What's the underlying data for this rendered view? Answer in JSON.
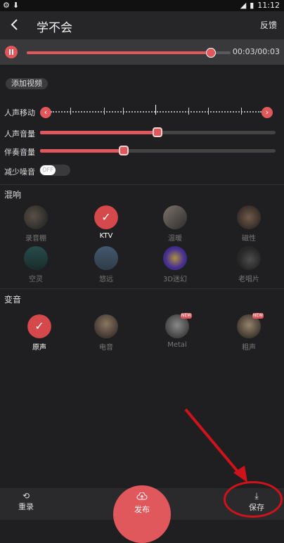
{
  "status": {
    "time": "11:12",
    "battery_icon": "battery-icon",
    "wifi_icon": "wifi-icon"
  },
  "header": {
    "title": "学不会",
    "feedback": "反馈"
  },
  "player": {
    "time": "00:03/00:03",
    "progress": 0.92
  },
  "add_video": "添加视频",
  "vocal_shift": {
    "label": "人声移动",
    "value": 0.5
  },
  "vocal_volume": {
    "label": "人声音量",
    "value": 0.5
  },
  "accompaniment_volume": {
    "label": "伴奏音量",
    "value": 0.36
  },
  "noise_reduction": {
    "label": "减少噪音",
    "state": "OFF"
  },
  "reverb": {
    "title": "混响",
    "items": [
      {
        "label": "录音棚",
        "icon": "studio-mic-icon",
        "active": false
      },
      {
        "label": "KTV",
        "icon": "check-icon",
        "active": true
      },
      {
        "label": "温暖",
        "icon": "piano-icon",
        "active": false
      },
      {
        "label": "磁性",
        "icon": "guitar-icon",
        "active": false
      },
      {
        "label": "空灵",
        "icon": "forest-icon",
        "active": false
      },
      {
        "label": "悠远",
        "icon": "birds-icon",
        "active": false
      },
      {
        "label": "3D迷幻",
        "icon": "psychedelic-icon",
        "active": false
      },
      {
        "label": "老唱片",
        "icon": "record-icon",
        "active": false
      }
    ]
  },
  "voice_change": {
    "title": "变音",
    "items": [
      {
        "label": "原声",
        "icon": "check-icon",
        "active": true,
        "new": false
      },
      {
        "label": "电音",
        "icon": "electric-guitar-icon",
        "active": false,
        "new": false
      },
      {
        "label": "Metal",
        "icon": "rock-hand-icon",
        "active": false,
        "new": true
      },
      {
        "label": "粗声",
        "icon": "cartoon-icon",
        "active": false,
        "new": true
      }
    ]
  },
  "bottom": {
    "rerecord": "重录",
    "publish": "发布",
    "save": "保存"
  },
  "colors": {
    "accent": "#e0585c",
    "background": "#1f1f21",
    "annotation": "#d0121b"
  }
}
